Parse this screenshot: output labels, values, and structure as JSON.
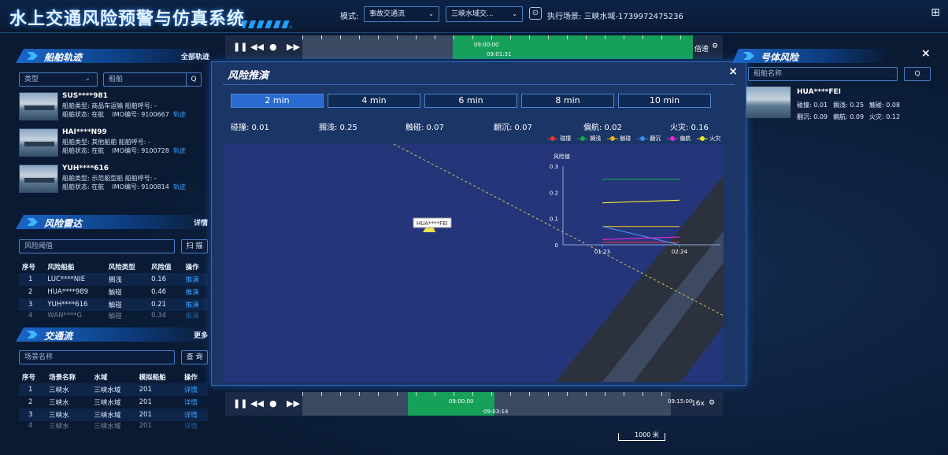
{
  "app": {
    "title": "水上交通风险预警与仿真系统"
  },
  "topbar": {
    "mode_label": "模式:",
    "mode_value": "事故交通流",
    "area_value": "三峡水域交...",
    "exec_label": "执行场景:",
    "exec_value": "三峡水域-1739972475236"
  },
  "left": {
    "track_panel": {
      "title": "船舶轨迹",
      "all_tracks": "全部轨迹",
      "type_placeholder": "类型",
      "ship_placeholder": "船舶",
      "ships": [
        {
          "name": "SUS****981",
          "line1": "船舶类型: 商品车运输 船舶呼号: -",
          "line2_status": "船舶状态: 在航",
          "line2_imo": "IMO编号: 9100667",
          "link": "轨迹"
        },
        {
          "name": "HAI****N99",
          "line1": "船舶类型: 其他船舶 船舶呼号: -",
          "line2_status": "船舶状态: 在航",
          "line2_imo": "IMO编号: 9100728",
          "link": "轨迹"
        },
        {
          "name": "YUH****616",
          "line1": "船舶类型: 示范船型船 船舶呼号: -",
          "line2_status": "船舶状态: 在航",
          "line2_imo": "IMO编号: 9100814",
          "link": "轨迹"
        }
      ]
    },
    "radar_panel": {
      "title": "风险雷达",
      "detail": "详情",
      "threshold_placeholder": "风险阈值",
      "scan_btn": "扫 描",
      "headers": [
        "序号",
        "风险船舶",
        "风险类型",
        "风险值",
        "操作"
      ],
      "rows": [
        [
          "1",
          "LUC****NIE",
          "搁浅",
          "0.16",
          "推演"
        ],
        [
          "2",
          "HUA****989",
          "触碰",
          "0.46",
          "推演"
        ],
        [
          "3",
          "YUH****616",
          "触碰",
          "0.21",
          "推演"
        ],
        [
          "4",
          "WAN****G",
          "触碰",
          "0.34",
          "推演"
        ]
      ]
    },
    "traffic_panel": {
      "title": "交通流",
      "more": "更多",
      "scene_placeholder": "场景名称",
      "query_btn": "查 询",
      "headers": [
        "序号",
        "场景名称",
        "水域",
        "模拟船舶",
        "操作"
      ],
      "rows": [
        [
          "1",
          "三峡水",
          "三峡水域",
          "201",
          "详情"
        ],
        [
          "2",
          "三峡水",
          "三峡水域",
          "201",
          "详情"
        ],
        [
          "3",
          "三峡水",
          "三峡水域",
          "201",
          "详情"
        ],
        [
          "4",
          "三峡水",
          "三峡水域",
          "201",
          "详情"
        ]
      ]
    }
  },
  "top_timeline": {
    "start": "09:00:00",
    "current": "09:01:31",
    "speed_label": "倍速"
  },
  "bottom_timeline": {
    "start": "09:00:00",
    "current": "09:03:14",
    "end": "09:15:00",
    "speed_label": "16x"
  },
  "modal": {
    "title": "风险推演",
    "close": "×",
    "tabs": [
      "2 min",
      "4 min",
      "6 min",
      "8 min",
      "10 min"
    ],
    "active_tab": 0,
    "stats": [
      "碰撞: 0.01",
      "搁浅: 0.25",
      "触碰: 0.07",
      "翻沉: 0.07",
      "偏航: 0.02",
      "火灾: 0.16"
    ],
    "ship_label": "HUA****FEI"
  },
  "chart_data": {
    "type": "line",
    "ylabel": "风险值",
    "x": [
      "01:23",
      "02:24"
    ],
    "ylim": [
      0,
      0.3
    ],
    "yticks": [
      0,
      0.1,
      0.2,
      0.3
    ],
    "legend_position": "top-right",
    "series": [
      {
        "name": "碰撞",
        "color": "#e8343a",
        "values": [
          0.01,
          0.01
        ]
      },
      {
        "name": "搁浅",
        "color": "#19a84a",
        "values": [
          0.25,
          0.25
        ]
      },
      {
        "name": "触碰",
        "color": "#e6b422",
        "values": [
          0.07,
          0.07
        ]
      },
      {
        "name": "翻沉",
        "color": "#3b8ff0",
        "values": [
          0.07,
          0.0
        ]
      },
      {
        "name": "偏航",
        "color": "#e02ad8",
        "values": [
          0.02,
          0.03
        ]
      },
      {
        "name": "火灾",
        "color": "#f2e629",
        "values": [
          0.16,
          0.17
        ]
      }
    ]
  },
  "right": {
    "panel_title": "号体风险",
    "close": "×",
    "search_placeholder": "船舶名称",
    "ship": {
      "name": "HUA****FEI",
      "row1": [
        "碰撞: 0.01",
        "搁浅: 0.25",
        "触碰: 0.08"
      ],
      "row2": [
        "翻沉: 0.09",
        "偏航: 0.09",
        "火灾: 0.12"
      ]
    }
  },
  "map": {
    "scale": "1000 米"
  }
}
